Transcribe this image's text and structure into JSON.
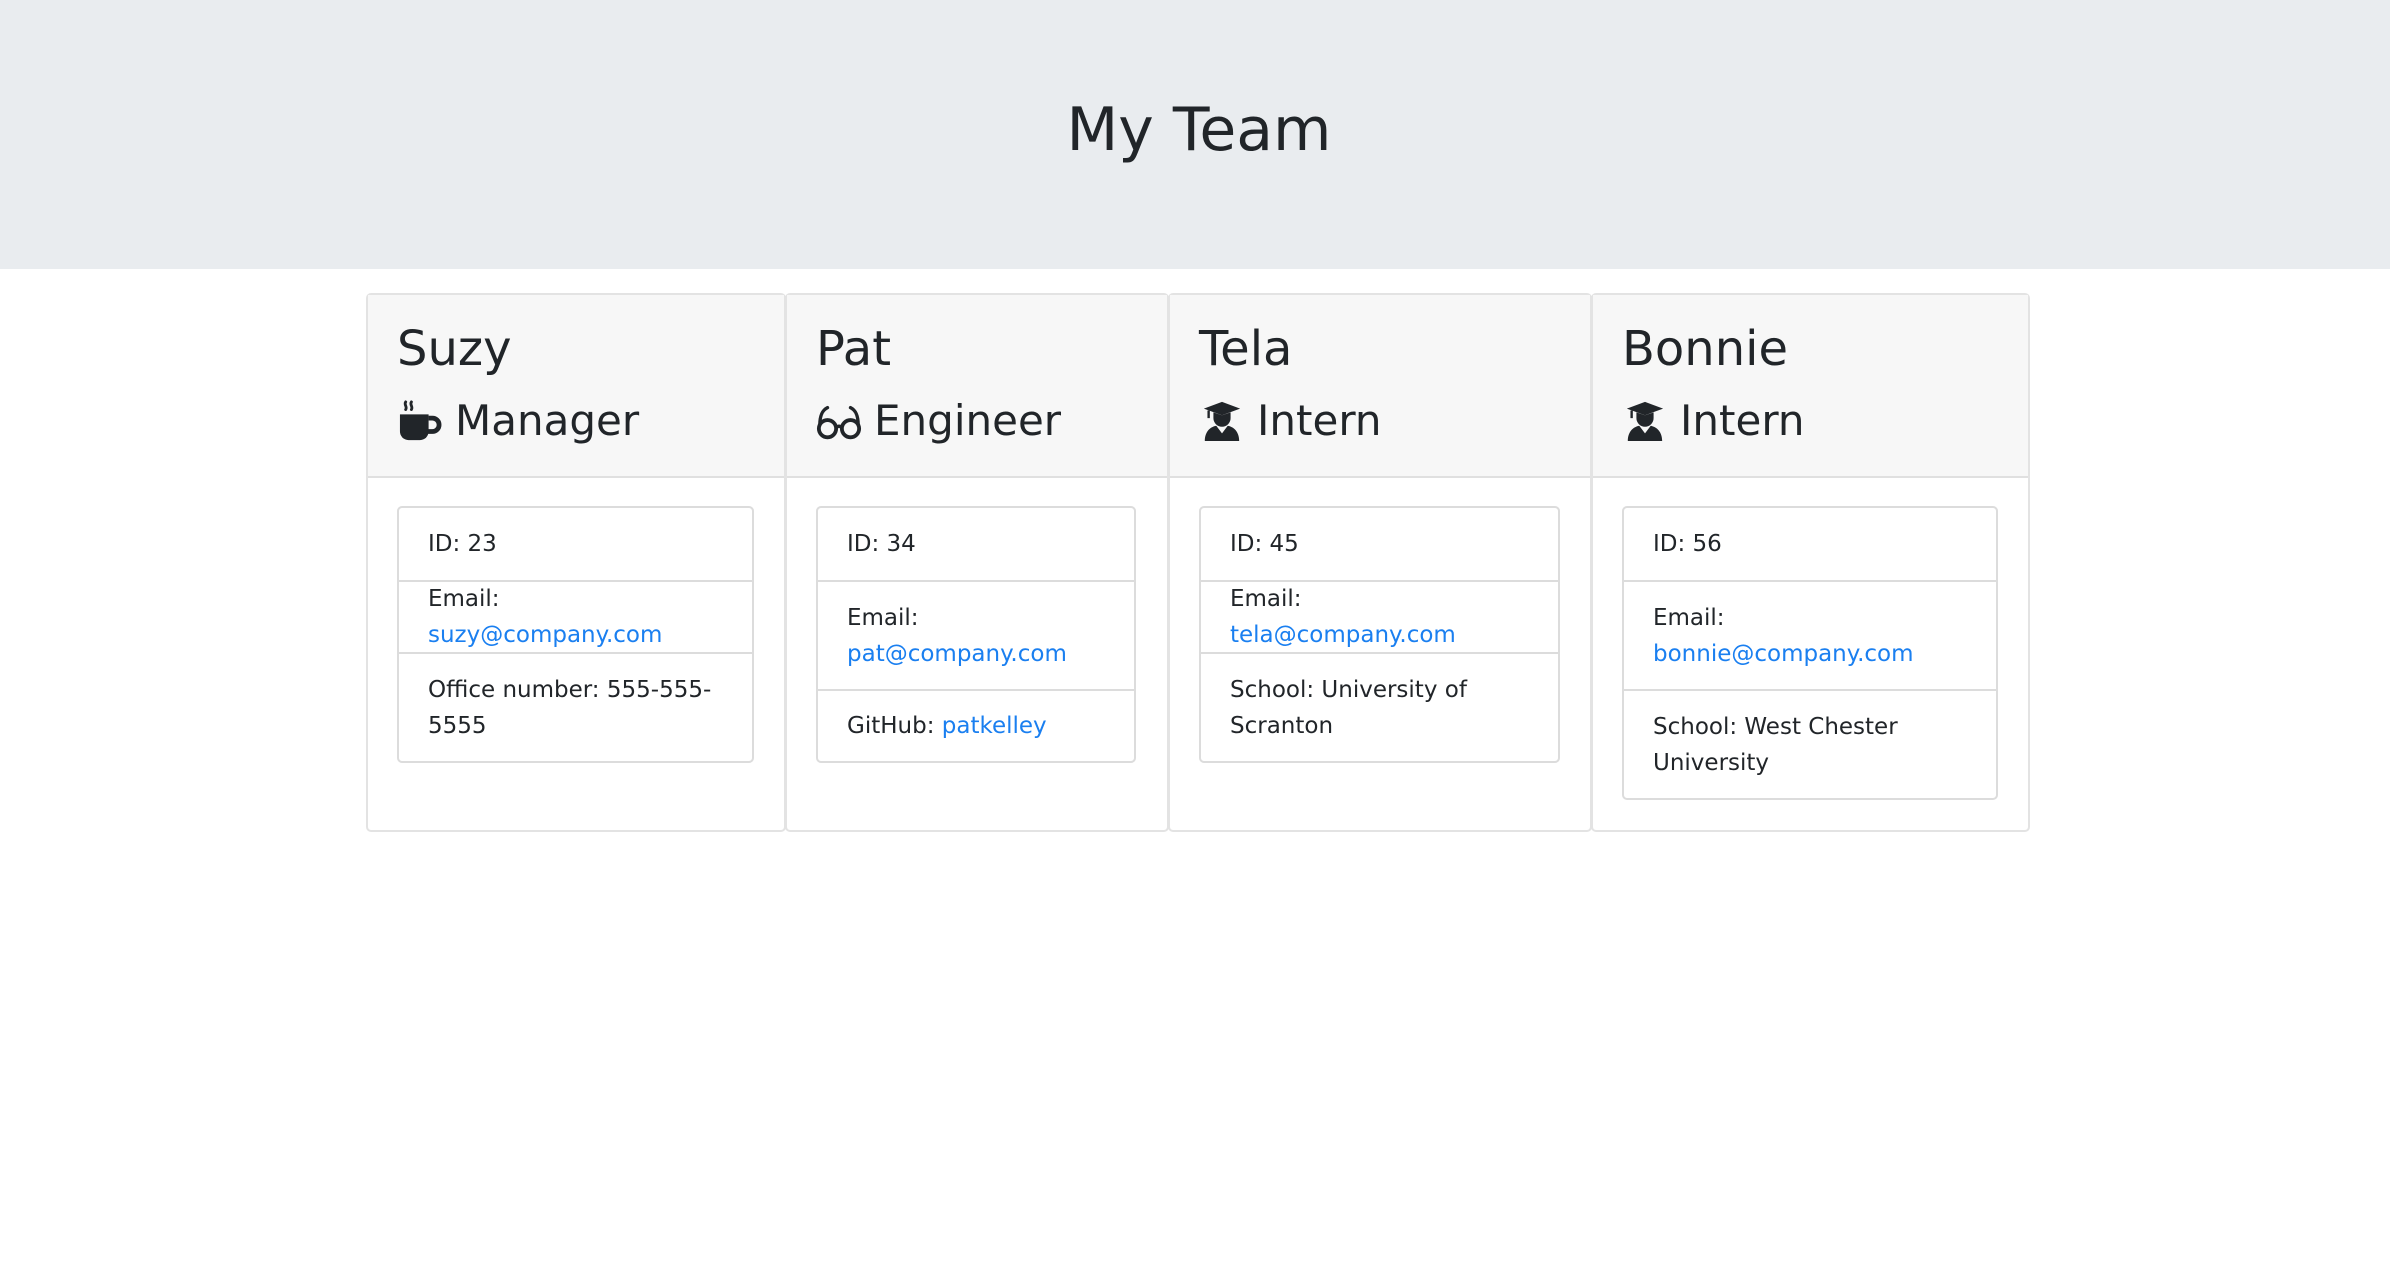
{
  "header": {
    "title": "My Team"
  },
  "cards": [
    {
      "name": "Suzy",
      "role": "Manager",
      "role_icon": "coffee-mug-icon",
      "id_label": "ID: 23",
      "email_prefix": "Email: ",
      "email": "suzy@company.com",
      "extra_text": "Office number: 555-555-5555"
    },
    {
      "name": "Pat",
      "role": "Engineer",
      "role_icon": "glasses-icon",
      "id_label": "ID: 34",
      "email_prefix": "Email:",
      "email": "pat@company.com",
      "extra_prefix": "GitHub: ",
      "extra_link": "patkelley"
    },
    {
      "name": "Tela",
      "role": "Intern",
      "role_icon": "graduate-icon",
      "id_label": "ID: 45",
      "email_prefix": "Email: ",
      "email": "tela@company.com",
      "extra_text": "School: University of Scranton"
    },
    {
      "name": "Bonnie",
      "role": "Intern",
      "role_icon": "graduate-icon",
      "id_label": "ID: 56",
      "email_prefix": "Email:",
      "email": "bonnie@company.com",
      "extra_text": "School: West Chester University"
    }
  ],
  "colors": {
    "link": "#1a7ff0",
    "header_bg": "#e9ecef",
    "card_header_bg": "#f7f7f7"
  }
}
